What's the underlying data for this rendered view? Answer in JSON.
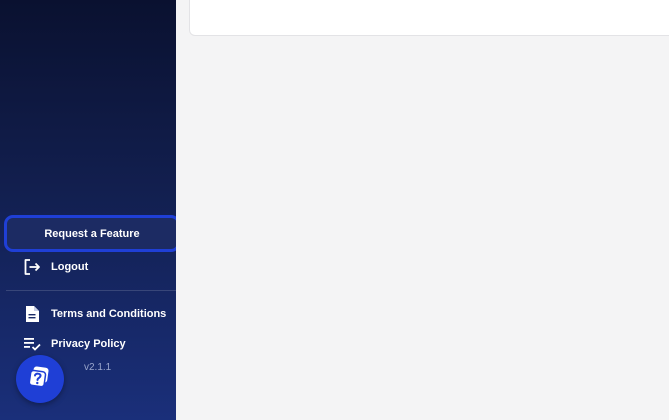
{
  "sidebar": {
    "request_feature_label": "Request a Feature",
    "logout_label": "Logout",
    "terms_label": "Terms and Conditions",
    "privacy_label": "Privacy Policy",
    "version": "v2.1.1"
  },
  "icons": {
    "logout": "logout-icon",
    "terms": "document-icon",
    "privacy": "list-check-icon",
    "help": "help-chat-icon"
  },
  "colors": {
    "sidebar_top": "#0a1130",
    "sidebar_bottom": "#1a2f7a",
    "accent": "#1f3fd6",
    "background": "#f4f4f5"
  }
}
